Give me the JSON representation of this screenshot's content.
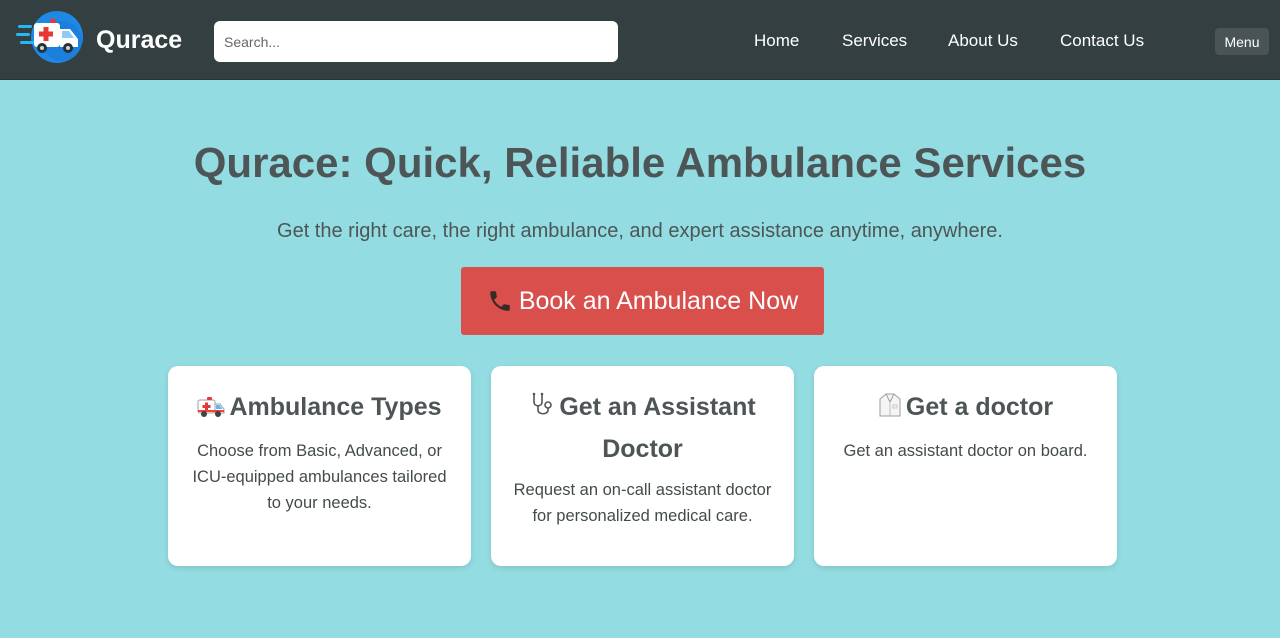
{
  "header": {
    "brand": "Qurace",
    "search_placeholder": "Search...",
    "nav": [
      "Home",
      "Services",
      "About Us",
      "Contact Us"
    ],
    "menu_label": "Menu"
  },
  "hero": {
    "title": "Qurace: Quick, Reliable Ambulance Services",
    "subtitle": "Get the right care, the right ambulance, and expert assistance anytime, anywhere.",
    "cta_label": "Book an Ambulance Now",
    "cta_icon": "phone-icon"
  },
  "cards": [
    {
      "icon": "ambulance-icon",
      "title": "Ambulance Types",
      "text": "Choose from Basic, Advanced, or ICU-equipped ambulances tailored to your needs."
    },
    {
      "icon": "stethoscope-icon",
      "title": "Get an Assistant Doctor",
      "text": "Request an on-call assistant doctor for personalized medical care."
    },
    {
      "icon": "lab-coat-icon",
      "title": "Get a doctor",
      "text": "Get an assistant doctor on board."
    }
  ],
  "colors": {
    "header_bg": "#343f42",
    "page_bg": "#93dde2",
    "cta_bg": "#d84f4b",
    "heading_text": "#4d5556",
    "logo_blue": "#1e88e5"
  }
}
